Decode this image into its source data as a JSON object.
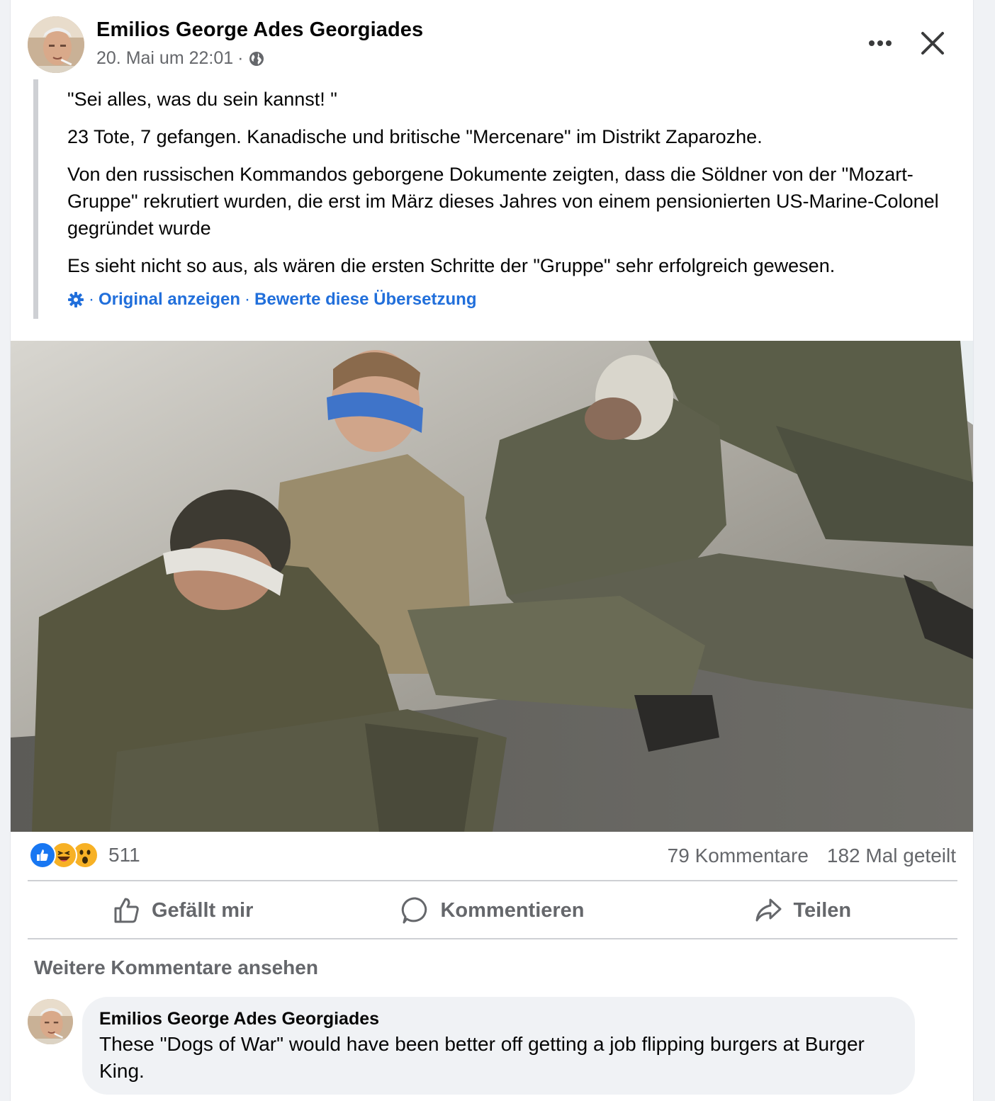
{
  "post": {
    "author": "Emilios George Ades Georgiades",
    "timestamp": "20. Mai um 22:01",
    "separator": "·",
    "privacy_icon": "globe-icon",
    "more_icon": "more-horizontal-icon",
    "close_icon": "close-icon",
    "paragraphs": [
      "\"Sei alles, was du sein kannst! \"",
      "23 Tote, 7 gefangen. Kanadische und britische \"Mercenare\" im Distrikt Zaparozhe.",
      "Von den russischen Kommandos geborgene Dokumente zeigten, dass die Söldner von der \"Mozart-Gruppe\" rekrutiert wurden, die erst im März dieses Jahres von einem pensionierten US-Marine-Colonel gegründet wurde",
      "Es sieht nicht so aus, als wären die ersten Schritte der \"Gruppe\" sehr erfolgreich gewesen."
    ],
    "translation": {
      "settings_icon": "gear-icon",
      "sep": "·",
      "show_original": "Original anzeigen",
      "rate": "Bewerte diese Übersetzung"
    }
  },
  "stats": {
    "reaction_icons": [
      "like-icon",
      "haha-icon",
      "wow-icon"
    ],
    "reaction_count": "511",
    "comments": "79 Kommentare",
    "shares": "182 Mal geteilt"
  },
  "actions": {
    "like": "Gefällt mir",
    "comment": "Kommentieren",
    "share": "Teilen"
  },
  "comments_section": {
    "more_label": "Weitere Kommentare ansehen",
    "items": [
      {
        "author": "Emilios George Ades Georgiades",
        "text": "These \"Dogs of War\" would have been better off getting a job flipping burgers at Burger King."
      }
    ]
  },
  "colors": {
    "link_blue": "#216fdb",
    "secondary_text": "#65676b",
    "like_blue": "#1877f2",
    "haha_yellow": "#f7b125"
  }
}
